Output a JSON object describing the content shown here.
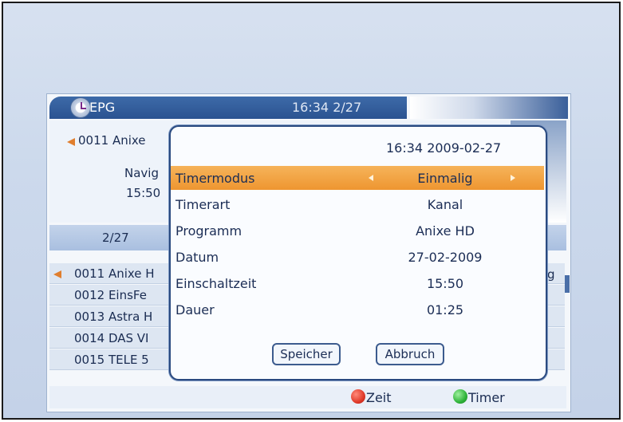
{
  "epg": {
    "title": "EPG",
    "time_page": "16:34 2/27",
    "channel": "0011 Anixe",
    "navig": "Navig",
    "time": "15:50",
    "tab_page": "2/27"
  },
  "channels": [
    {
      "label": "0011 Anixe H",
      "selected": true
    },
    {
      "label": "0012 EinsFe",
      "selected": false
    },
    {
      "label": "0013 Astra H",
      "selected": false
    },
    {
      "label": "0014 DAS VI",
      "selected": false
    },
    {
      "label": "0015 TELE 5",
      "selected": false
    }
  ],
  "right_fragment": "g",
  "dialog": {
    "datetime": "16:34 2009-02-27",
    "rows": [
      {
        "label": "Timermodus",
        "value": "Einmalig",
        "selected": true
      },
      {
        "label": "Timerart",
        "value": "Kanal",
        "selected": false
      },
      {
        "label": "Programm",
        "value": "Anixe HD",
        "selected": false
      },
      {
        "label": "Datum",
        "value": "27-02-2009",
        "selected": false
      },
      {
        "label": "Einschaltzeit",
        "value": "15:50",
        "selected": false
      },
      {
        "label": "Dauer",
        "value": "01:25",
        "selected": false
      }
    ],
    "save_label": "Speicher",
    "cancel_label": "Abbruch"
  },
  "footer": {
    "red_label": "Zeit",
    "green_label": "Timer",
    "red_color": "#e03a2a",
    "green_color": "#2fb33a"
  },
  "colors": {
    "accent_orange": "#ee9630",
    "title_blue": "#2b5391"
  },
  "icons": [
    "clock-icon",
    "arrow-icon",
    "triangle-left-icon",
    "triangle-right-icon",
    "red-button-icon",
    "green-button-icon"
  ]
}
